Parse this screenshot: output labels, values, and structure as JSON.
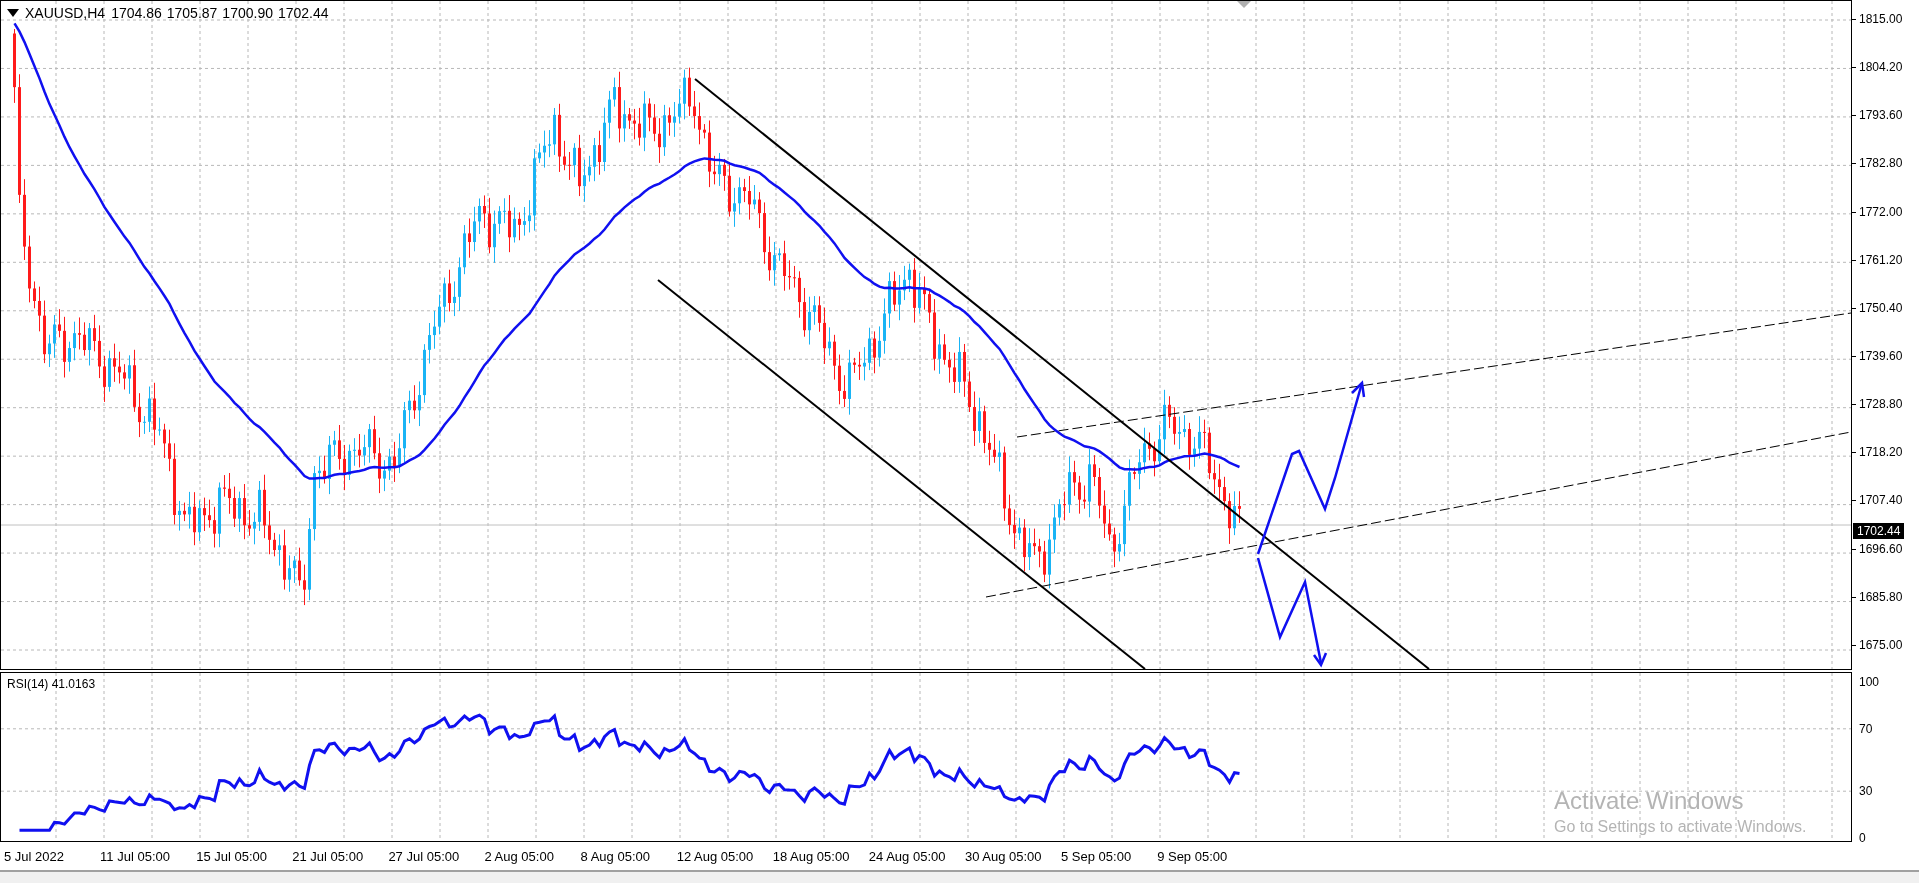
{
  "symbol_header": {
    "symbol": "XAUUSD,H4",
    "open": "1704.86",
    "high": "1705.87",
    "low": "1700.90",
    "close": "1702.44"
  },
  "price_axis": {
    "ticks": [
      "1815.00",
      "1804.20",
      "1793.60",
      "1782.80",
      "1772.00",
      "1761.20",
      "1750.40",
      "1739.60",
      "1728.80",
      "1718.20",
      "1707.40",
      "1696.60",
      "1685.80",
      "1675.00"
    ],
    "current_price": "1702.44"
  },
  "rsi_pane": {
    "label": "RSI(14) 41.0163",
    "ticks": [
      "100",
      "70",
      "30",
      "0"
    ]
  },
  "time_axis": {
    "ticks": [
      "5 Jul 2022",
      "11 Jul 05:00",
      "15 Jul 05:00",
      "21 Jul 05:00",
      "27 Jul 05:00",
      "2 Aug 05:00",
      "8 Aug 05:00",
      "12 Aug 05:00",
      "18 Aug 05:00",
      "24 Aug 05:00",
      "30 Aug 05:00",
      "5 Sep 05:00",
      "9 Sep 05:00"
    ]
  },
  "activation_notice": {
    "title": "Activate Windows",
    "subtitle": "Go to Settings to activate Windows."
  }
}
